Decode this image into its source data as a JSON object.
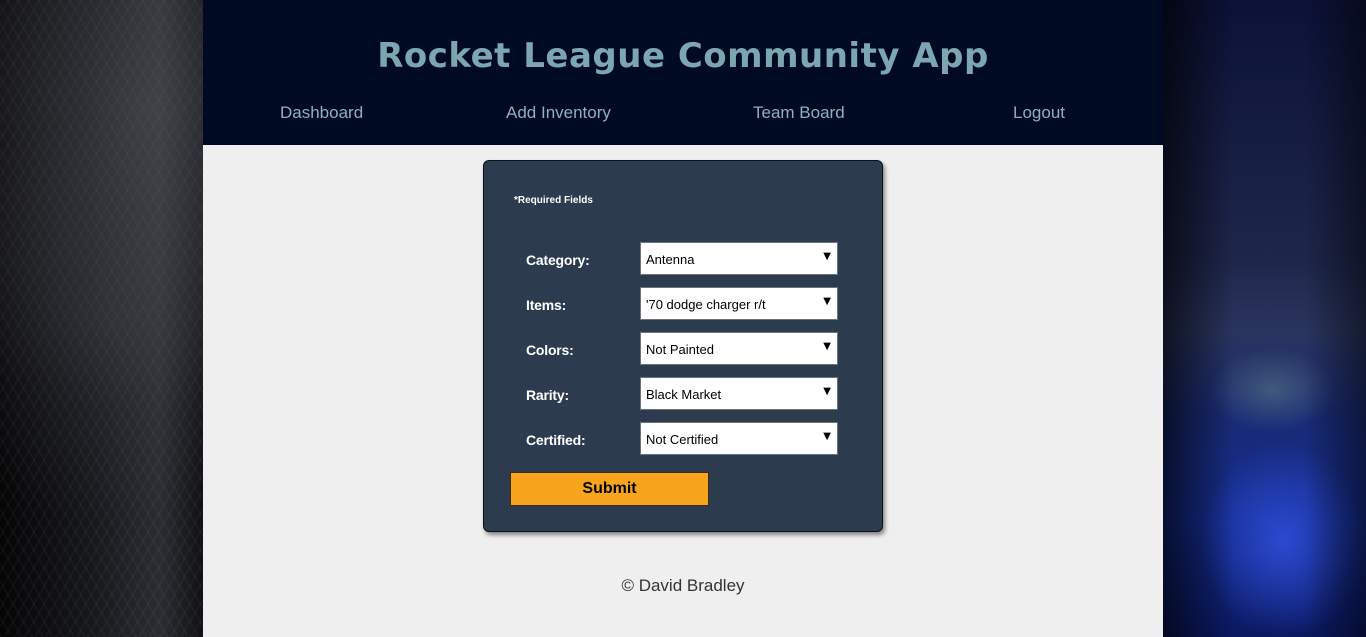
{
  "header": {
    "title": "Rocket League Community App",
    "nav": [
      {
        "label": "Dashboard"
      },
      {
        "label": "Add Inventory"
      },
      {
        "label": "Team Board"
      },
      {
        "label": "Logout"
      }
    ]
  },
  "form": {
    "required_note": "*Required Fields",
    "fields": [
      {
        "label": "Category:",
        "value": "Antenna"
      },
      {
        "label": "Items:",
        "value": "'70 dodge charger r/t"
      },
      {
        "label": "Colors:",
        "value": "Not Painted"
      },
      {
        "label": "Rarity:",
        "value": "Black Market"
      },
      {
        "label": "Certified:",
        "value": "Not Certified"
      }
    ],
    "submit_label": "Submit"
  },
  "footer": {
    "text": "© David Bradley"
  },
  "colors": {
    "header_bg": "#000a22",
    "title": "#7ca6b0",
    "form_bg": "#2d3b4f",
    "submit_bg": "#f7a51c",
    "page_bg": "#efefef"
  },
  "icons": {
    "dropdown": "chevron-down-icon"
  }
}
